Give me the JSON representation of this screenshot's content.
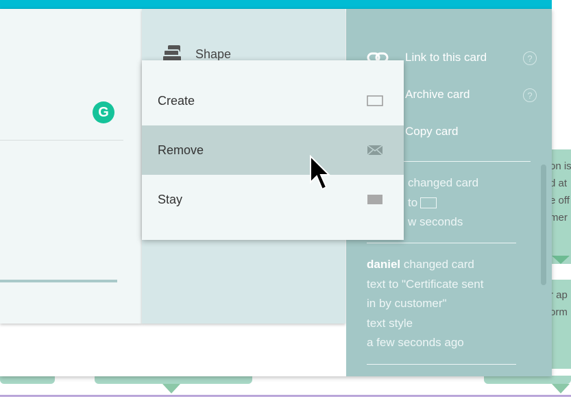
{
  "sidebar": {
    "shape_label": "Shape"
  },
  "editor": {
    "grammarly_letter": "G"
  },
  "menu": {
    "items": [
      {
        "label": "Link to this card",
        "icon": "link-icon",
        "help": "?"
      },
      {
        "label": "Archive card",
        "icon": "archive-icon",
        "help": "?"
      },
      {
        "label": "Copy card",
        "icon": "copy-icon"
      }
    ]
  },
  "activity": [
    {
      "line1": "changed card",
      "line2": "to",
      "line3": "w seconds"
    },
    {
      "user": "daniel",
      "action": " changed card",
      "line2": "text to \"Certificate sent",
      "line3": "in by customer\"",
      "line4": "text style",
      "time": "a few seconds ago"
    }
  ],
  "dropdown": {
    "options": [
      {
        "label": "Create",
        "icon": "rect-outline-icon"
      },
      {
        "label": "Remove",
        "icon": "envelope-icon",
        "selected": true
      },
      {
        "label": "Stay",
        "icon": "rect-filled-icon"
      }
    ]
  },
  "board_cards": [
    {
      "lines": [
        "on is",
        "d at",
        "e off",
        "mer"
      ]
    },
    {
      "lines": [
        "r ap",
        "orm"
      ]
    }
  ],
  "colors": {
    "accent": "#00bcd4",
    "activity_panel": "#a3c7c6",
    "selected_row": "#c0d3d2",
    "grammarly": "#15c39a"
  }
}
